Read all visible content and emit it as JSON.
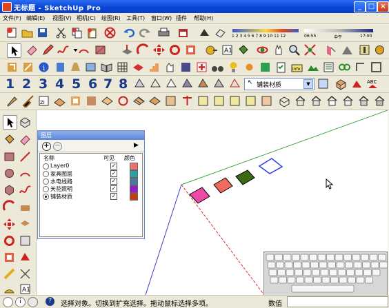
{
  "window": {
    "title": "无标题 - SketchUp Pro"
  },
  "menu": [
    {
      "label": "文件(F)"
    },
    {
      "label": "编辑(E)"
    },
    {
      "label": "视图(V)"
    },
    {
      "label": "相机(C)"
    },
    {
      "label": "绘图(R)"
    },
    {
      "label": "工具(T)"
    },
    {
      "label": "窗口(W)"
    },
    {
      "label": "插件"
    },
    {
      "label": "帮助(H)"
    }
  ],
  "shadow_bar": {
    "months": "1 2 3 4 5 6 7 8 9 10 11 12",
    "time_start": "06:55",
    "time_mid": "中午",
    "time_end": "17:00"
  },
  "view_numbers": [
    "1",
    "2",
    "3",
    "4",
    "5",
    "6",
    "7",
    "8"
  ],
  "material_dropdown": {
    "value": "铺装材质"
  },
  "layers_panel": {
    "title": "图层",
    "columns": {
      "name": "名称",
      "visible": "可见",
      "color": "颜色"
    },
    "rows": [
      {
        "name": "Layer0",
        "active": false,
        "visible": true,
        "color": "#f07070"
      },
      {
        "name": "家具图层",
        "active": false,
        "visible": true,
        "color": "#2aa0a0"
      },
      {
        "name": "水电线路",
        "active": false,
        "visible": true,
        "color": "#4a7a9a"
      },
      {
        "name": "天花照明",
        "active": false,
        "visible": true,
        "color": "#9a1ad0"
      },
      {
        "name": "铺装材质",
        "active": true,
        "visible": true,
        "color": "#c83a12"
      }
    ]
  },
  "scene_tiles": [
    {
      "name": "pink-tile",
      "color": "#f04aa8"
    },
    {
      "name": "coral-tile",
      "color": "#f06a60"
    },
    {
      "name": "green-tile",
      "color": "#3a6a12"
    },
    {
      "name": "white-tile",
      "color": "#ffffff"
    }
  ],
  "status": {
    "message": "选择对象。切换到扩充选择。拖动鼠标选择多项。",
    "value_label": "数值",
    "value": ""
  }
}
